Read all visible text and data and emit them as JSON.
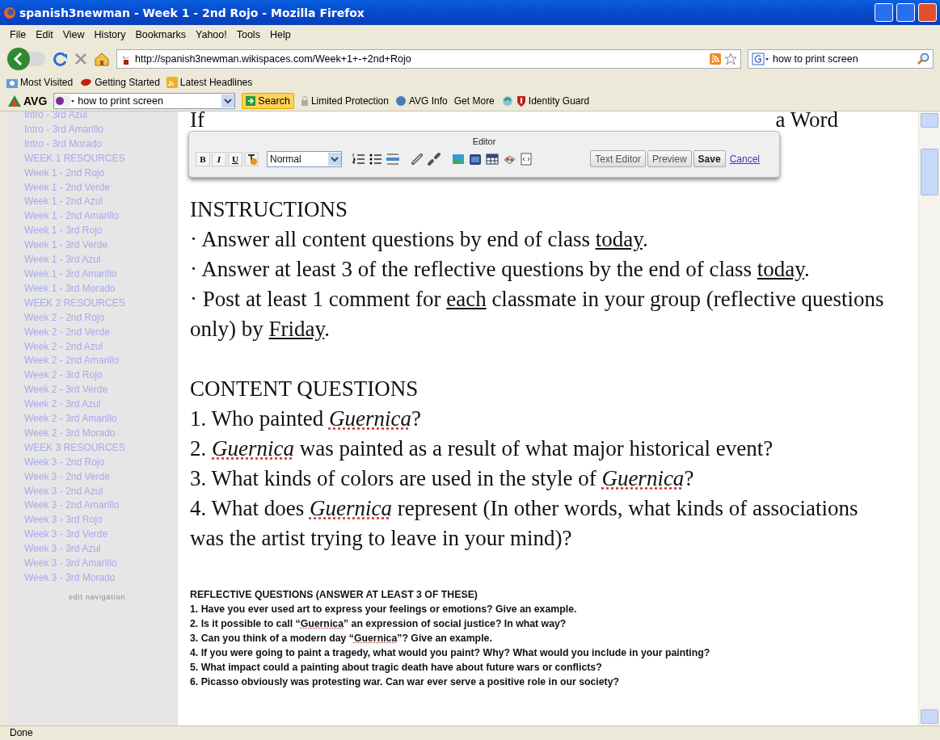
{
  "window": {
    "title": "spanish3newman - Week 1 - 2nd Rojo - Mozilla Firefox"
  },
  "menu": [
    "File",
    "Edit",
    "View",
    "History",
    "Bookmarks",
    "Yahoo!",
    "Tools",
    "Help"
  ],
  "address_bar": {
    "value": "http://spanish3newman.wikispaces.com/Week+1+-+2nd+Rojo"
  },
  "search_bar": {
    "value": "how to print screen"
  },
  "bookmarks": [
    "Most Visited",
    "Getting Started",
    "Latest Headlines"
  ],
  "avg_toolbar": {
    "logo": "AVG",
    "search_value": "how to print screen",
    "search_button": "Search",
    "items": [
      "Limited Protection",
      "AVG Info",
      "Get More",
      "Identity Guard"
    ]
  },
  "sidebar": {
    "items": [
      "Intro - 3rd Azul",
      "Intro - 3rd Amarillo",
      "Intro - 3rd Morado",
      "WEEK 1 RESOURCES",
      "Week 1 - 2nd Rojo",
      "Week 1 - 2nd Verde",
      "Week 1 - 2nd Azul",
      "Week 1 - 2nd Amarillo",
      "Week 1 - 3rd Rojo",
      "Week 1 - 3rd Verde",
      "Week 1 - 3rd Azul",
      "Week 1 - 3rd Amarillo",
      "Week 1 - 3rd Morado",
      "WEEK 2 RESOURCES",
      "Week 2 - 2nd Rojo",
      "Week 2 - 2nd Verde",
      "Week 2 - 2nd Azul",
      "Week 2 - 2nd Amarillo",
      "Week 2 - 3rd Rojo",
      "Week 2 - 3rd Verde",
      "Week 2 - 3rd Azul",
      "Week 2 - 3rd Amarillo",
      "Week 2 - 3rd Morado",
      "WEEK 3 RESOURCES",
      "Week 3 - 2nd Rojo",
      "Week 3 - 2nd Verde",
      "Week 3 - 2nd Azul",
      "Week 3 - 2nd Amarillo",
      "Week 3 - 3rd Rojo",
      "Week 3 - 3rd Verde",
      "Week 3 - 3rd Azul",
      "Week 3 - 3rd Amarillo",
      "Week 3 - 3rd Morado"
    ],
    "edit_link": "edit navigation"
  },
  "editor": {
    "title": "Editor",
    "format_buttons": [
      "B",
      "I",
      "U"
    ],
    "format": "Normal",
    "buttons": [
      "Text Editor",
      "Preview",
      "Save"
    ],
    "cancel": "Cancel"
  },
  "content": {
    "partial_line": [
      "If",
      "a Word"
    ],
    "blocks": [
      {
        "kind": "heading",
        "segments": [
          {
            "kind": "plain",
            "text": "INSTRUCTIONS"
          }
        ]
      },
      {
        "kind": "line",
        "segments": [
          {
            "kind": "plain",
            "text": "· Answer all content questions by end of class "
          },
          {
            "kind": "underline",
            "text": "today"
          },
          {
            "kind": "plain",
            "text": "."
          }
        ]
      },
      {
        "kind": "line",
        "segments": [
          {
            "kind": "plain",
            "text": "· Answer at least 3 of the reflective questions by the end of class "
          },
          {
            "kind": "underline",
            "text": "today"
          },
          {
            "kind": "plain",
            "text": "."
          }
        ]
      },
      {
        "kind": "line",
        "segments": [
          {
            "kind": "plain",
            "text": "· Post at least 1 comment for "
          },
          {
            "kind": "underline",
            "text": "each"
          },
          {
            "kind": "plain",
            "text": " classmate in your group (reflective questions only) by "
          },
          {
            "kind": "underline",
            "text": "Friday"
          },
          {
            "kind": "plain",
            "text": "."
          }
        ]
      },
      {
        "kind": "heading",
        "segments": [
          {
            "kind": "plain",
            "text": "CONTENT QUESTIONS"
          }
        ]
      },
      {
        "kind": "line",
        "segments": [
          {
            "kind": "plain",
            "text": "1. Who painted "
          },
          {
            "kind": "italic",
            "text": "Guernica"
          },
          {
            "kind": "plain",
            "text": "?"
          }
        ]
      },
      {
        "kind": "line",
        "segments": [
          {
            "kind": "plain",
            "text": "2. "
          },
          {
            "kind": "italic",
            "text": "Guernica"
          },
          {
            "kind": "plain",
            "text": " was painted as a result of what major historical event?"
          }
        ]
      },
      {
        "kind": "line",
        "segments": [
          {
            "kind": "plain",
            "text": "3. What kinds of colors are used in the style of "
          },
          {
            "kind": "italic",
            "text": "Guernica"
          },
          {
            "kind": "plain",
            "text": "?"
          }
        ]
      },
      {
        "kind": "line",
        "segments": [
          {
            "kind": "plain",
            "text": "4. What does "
          },
          {
            "kind": "italic",
            "text": "Guernica"
          },
          {
            "kind": "plain",
            "text": " represent (In other words, what kinds of associations was the artist trying to leave in your mind)?"
          }
        ]
      },
      {
        "kind": "small-heading",
        "segments": [
          {
            "kind": "plain",
            "text": "REFLECTIVE QUESTIONS (ANSWER AT LEAST 3 OF THESE)"
          }
        ]
      },
      {
        "kind": "small",
        "segments": [
          {
            "kind": "plain",
            "text": "1. Have you ever used art to express your feelings or emotions? Give an example."
          }
        ]
      },
      {
        "kind": "small",
        "segments": [
          {
            "kind": "plain",
            "text": "2. Is it possible to call “"
          },
          {
            "kind": "misspelled",
            "text": "Guernica"
          },
          {
            "kind": "plain",
            "text": "” an expression of social justice? In what way?"
          }
        ]
      },
      {
        "kind": "small",
        "segments": [
          {
            "kind": "plain",
            "text": "3. Can you think of a modern day “"
          },
          {
            "kind": "misspelled",
            "text": "Guernica"
          },
          {
            "kind": "plain",
            "text": "”? Give an example."
          }
        ]
      },
      {
        "kind": "small",
        "segments": [
          {
            "kind": "plain",
            "text": "4. If you were going to paint a tragedy, what would you paint? Why? What would you include in your painting?"
          }
        ]
      },
      {
        "kind": "small",
        "segments": [
          {
            "kind": "plain",
            "text": "5. What impact could a painting about tragic death have about future wars or conflicts?"
          }
        ]
      },
      {
        "kind": "small",
        "segments": [
          {
            "kind": "plain",
            "text": "6. Picasso obviously was protesting war. Can war ever serve a positive role in our society?"
          }
        ]
      }
    ]
  },
  "status_bar": {
    "text": "Done"
  }
}
